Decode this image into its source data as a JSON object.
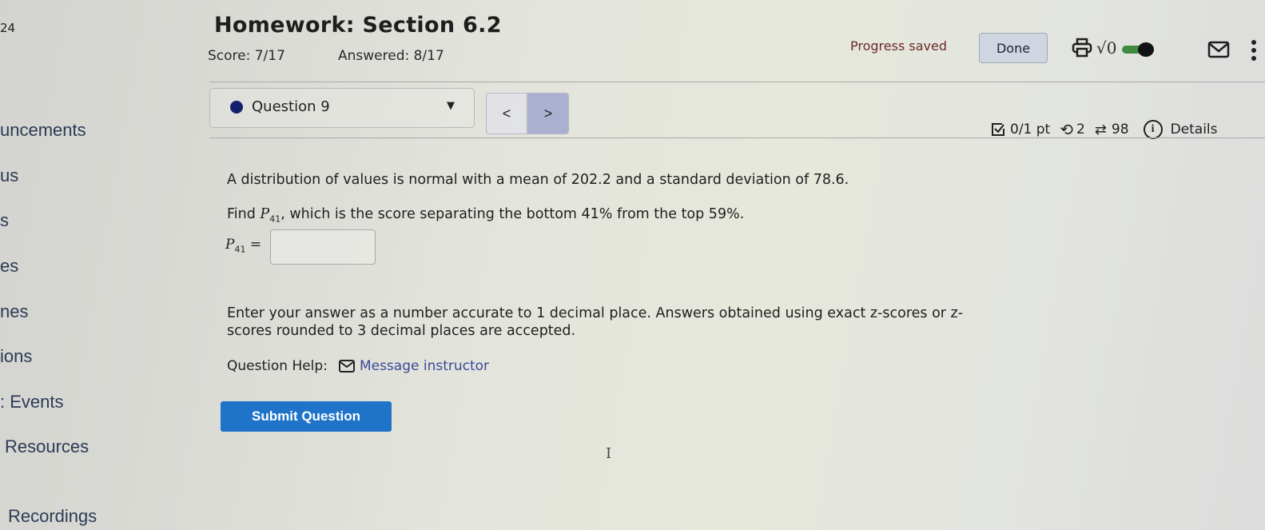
{
  "sidebar": {
    "partial_number": "24",
    "items": [
      {
        "label": "uncements"
      },
      {
        "label": "us"
      },
      {
        "label": "s"
      },
      {
        "label": "es"
      },
      {
        "label": "nes"
      },
      {
        "label": "ions"
      },
      {
        "label": ": Events"
      },
      {
        "label": "Resources"
      },
      {
        "label": "Recordings"
      }
    ]
  },
  "header": {
    "title": "Homework: Section 6.2",
    "score": "Score: 7/17",
    "answered": "Answered: 8/17",
    "progress_status": "Progress saved",
    "done_label": "Done",
    "icons": [
      "printer-icon",
      "sqrt-icon",
      "toggle-switch",
      "mail-icon",
      "more-vertical-icon"
    ],
    "sqrt_label": "√0",
    "toggle_on": true
  },
  "question_nav": {
    "selected_question": "Question 9",
    "prev_label": "<",
    "next_label": ">"
  },
  "question_meta": {
    "points": "0/1 pt",
    "retries": "2",
    "attempts": "98",
    "details_label": "Details"
  },
  "question": {
    "line1": "A distribution of values is normal with a mean of 202.2 and a standard deviation of 78.6.",
    "find_prefix": "Find ",
    "p_symbol": "P",
    "p_subscript": "41",
    "find_suffix": ", which is the score separating the bottom 41% from the top 59%.",
    "answer_eq": "=",
    "answer_value": "",
    "instruction_line1": "Enter your answer as a number accurate to 1 decimal place. Answers obtained using exact z-scores or z-",
    "instruction_line2": "scores rounded to 3 decimal places are accepted.",
    "help_label": "Question Help:",
    "message_instructor": "Message instructor",
    "submit_label": "Submit Question"
  },
  "colors": {
    "submit_bg": "#1f74c9",
    "link": "#3a4a9a",
    "progress_text": "#6b2a2a",
    "question_dot": "#14206b",
    "toggle_track": "#3f8a3f"
  }
}
